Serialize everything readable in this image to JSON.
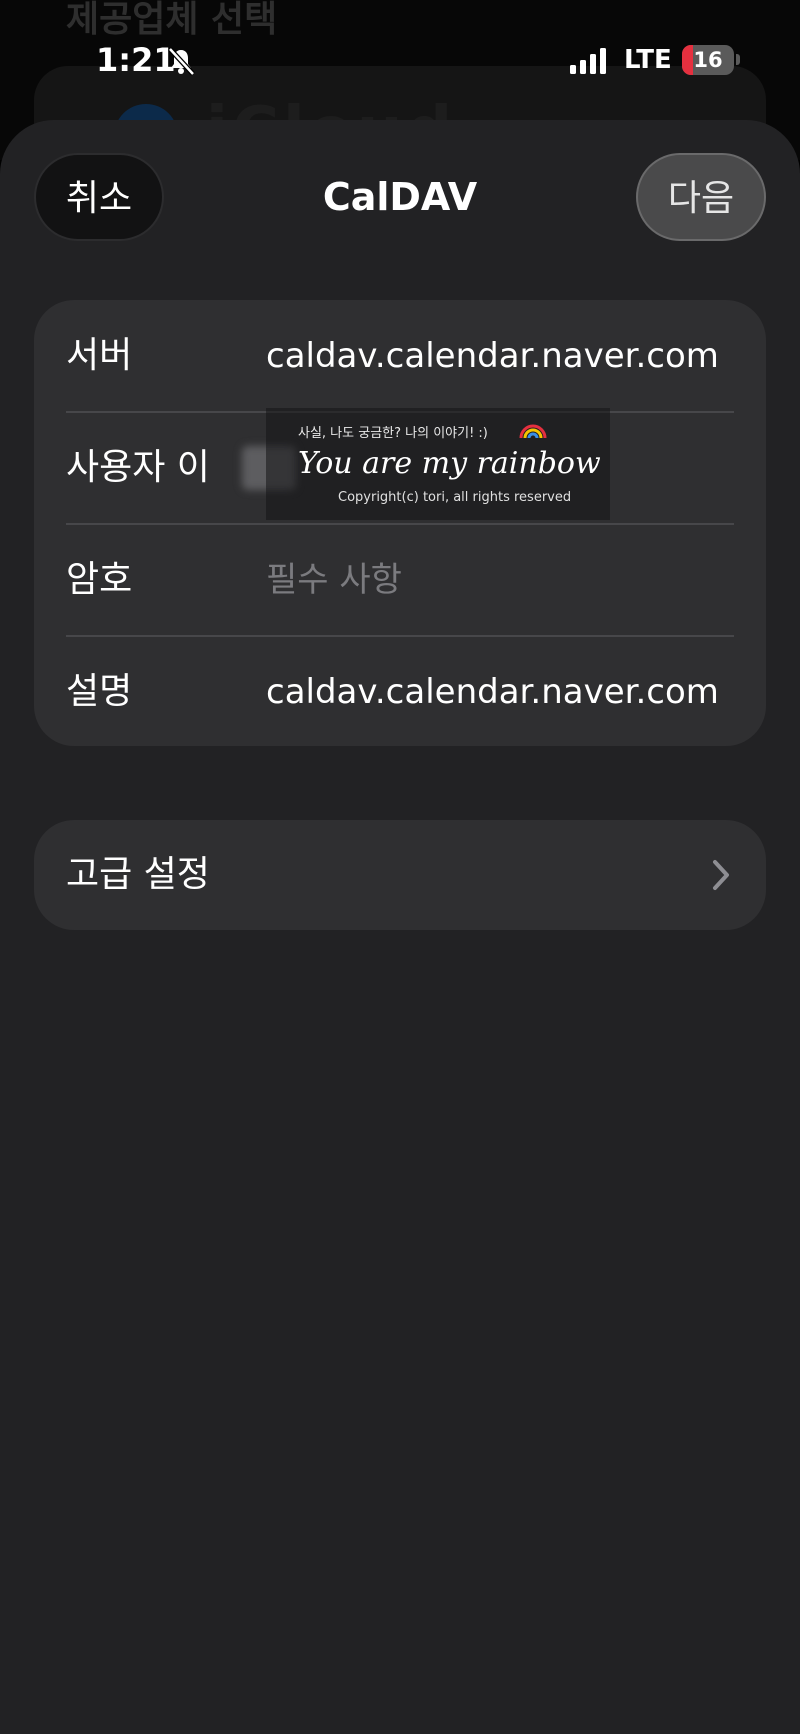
{
  "background": {
    "title": "제공업체 선택",
    "provider_word": "iCloud"
  },
  "status_bar": {
    "time": "1:21",
    "network": "LTE",
    "battery_level": "16",
    "battery_fraction": 0.16,
    "icons": [
      "bell-slash-icon",
      "signal-icon",
      "battery-icon"
    ]
  },
  "nav": {
    "cancel_label": "취소",
    "title": "CalDAV",
    "next_label": "다음"
  },
  "form": {
    "rows": [
      {
        "label": "서버",
        "value": "caldav.calendar.naver.com"
      },
      {
        "label": "사용자 이",
        "value": ""
      },
      {
        "label": "암호",
        "placeholder": "필수 사항"
      },
      {
        "label": "설명",
        "value": "caldav.calendar.naver.com"
      }
    ]
  },
  "watermark": {
    "top_text": "사실, 나도 궁금한? 나의 이야기! :)",
    "main_text": "You are my rainbow",
    "copyright": "Copyright(c) tori, all rights reserved"
  },
  "advanced": {
    "label": "고급 설정"
  },
  "colors": {
    "sheet": "#222224",
    "card": "#2f2f31",
    "divider": "#47474a",
    "battery_low": "#e5303f",
    "placeholder": "#7b7b7f"
  }
}
